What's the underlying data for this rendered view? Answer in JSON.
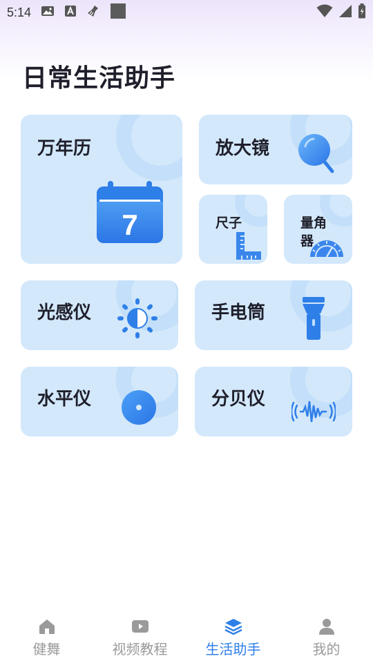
{
  "status_bar": {
    "time": "5:14",
    "left_icons": [
      "image-icon",
      "font-icon",
      "broom-icon",
      "square-icon"
    ],
    "right_icons": [
      "wifi-icon",
      "signal-icon",
      "battery-icon"
    ]
  },
  "page_title": "日常生活助手",
  "tools": {
    "calendar": {
      "label": "万年历",
      "icon": "calendar-icon",
      "icon_text": "7"
    },
    "magnifier": {
      "label": "放大镜",
      "icon": "magnifier-icon"
    },
    "ruler": {
      "label": "尺子",
      "icon": "ruler-icon"
    },
    "protractor": {
      "label": "量角器",
      "icon": "protractor-icon"
    },
    "light_meter": {
      "label": "光感仪",
      "icon": "sun-icon"
    },
    "flashlight": {
      "label": "手电筒",
      "icon": "flashlight-icon"
    },
    "level": {
      "label": "水平仪",
      "icon": "level-icon"
    },
    "decibel": {
      "label": "分贝仪",
      "icon": "soundwave-icon"
    }
  },
  "tab_bar": {
    "active_color": "#2f7fe8",
    "inactive_color": "#9a9a9a",
    "items": [
      {
        "label": "健舞",
        "icon": "home-icon",
        "active": false
      },
      {
        "label": "视频教程",
        "icon": "video-icon",
        "active": false
      },
      {
        "label": "生活助手",
        "icon": "layers-icon",
        "active": true
      },
      {
        "label": "我的",
        "icon": "person-icon",
        "active": false
      }
    ]
  },
  "colors": {
    "card_bg": "#d3e8fb",
    "icon_blue": "#2f7fe8",
    "icon_light": "#5aa9f5"
  }
}
